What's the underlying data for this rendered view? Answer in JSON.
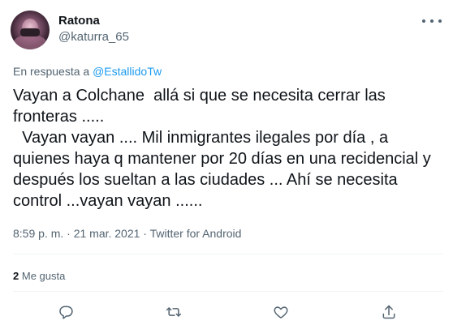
{
  "author": {
    "display_name": "Ratona",
    "handle": "@katurra_65"
  },
  "reply": {
    "prefix": "En respuesta a ",
    "mention": "@EstallidoTw"
  },
  "tweet": {
    "text": "Vayan a Colchane  allá si que se necesita cerrar las fronteras .....\n  Vayan vayan .... Mil inmigrantes ilegales por día , a quienes haya q mantener por 20 días en una recidencial y después los sueltan a las ciudades ... Ahí se necesita control ...vayan vayan ......",
    "meta": "8:59 p. m. · 21 mar. 2021 · Twitter for Android"
  },
  "stats": {
    "likes_count": "2",
    "likes_label": "Me gusta"
  },
  "icons": {
    "more": "more-dots-icon",
    "reply": "reply-bubble-icon",
    "retweet": "retweet-icon",
    "like": "heart-icon",
    "share": "share-upload-icon"
  },
  "colors": {
    "link": "#1d9bf0",
    "secondary_text": "#536471",
    "primary_text": "#0f1419"
  }
}
